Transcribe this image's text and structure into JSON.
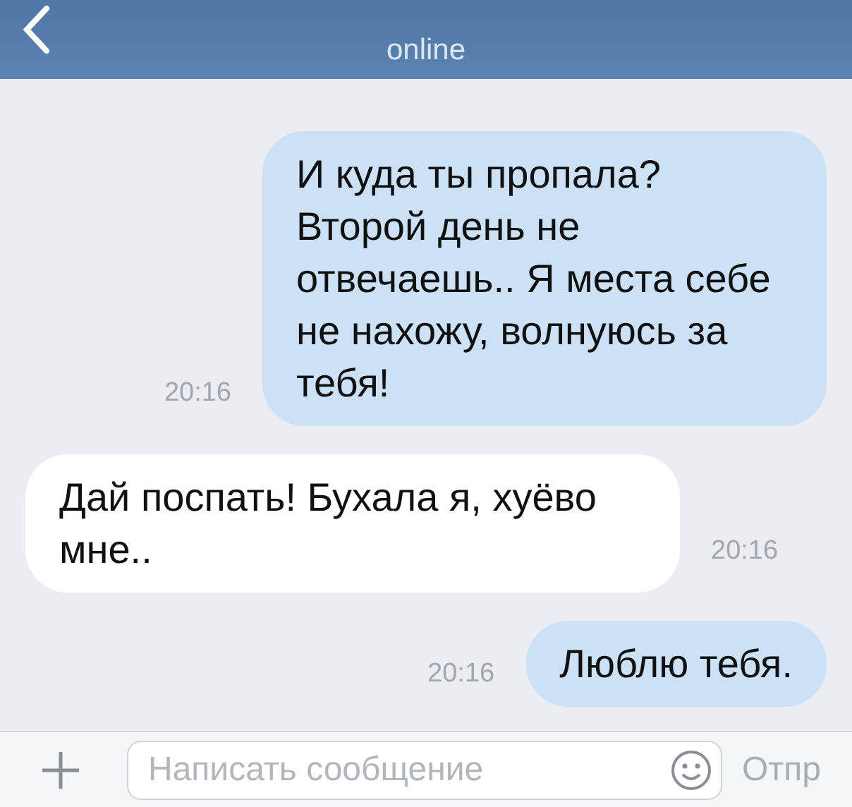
{
  "header": {
    "status": "online"
  },
  "messages": [
    {
      "kind": "outgoing",
      "text": "И куда ты пропала? Второй день не отвечаешь.. Я места себе не нахожу, волнуюсь за тебя!",
      "time": "20:16"
    },
    {
      "kind": "incoming",
      "text": "Дай поспать! Бухала я, хуёво мне..",
      "time": "20:16"
    },
    {
      "kind": "outgoing",
      "text": "Люблю тебя.",
      "time": "20:16"
    }
  ],
  "composer": {
    "placeholder": "Написать сообщение",
    "send": "Отпр"
  }
}
